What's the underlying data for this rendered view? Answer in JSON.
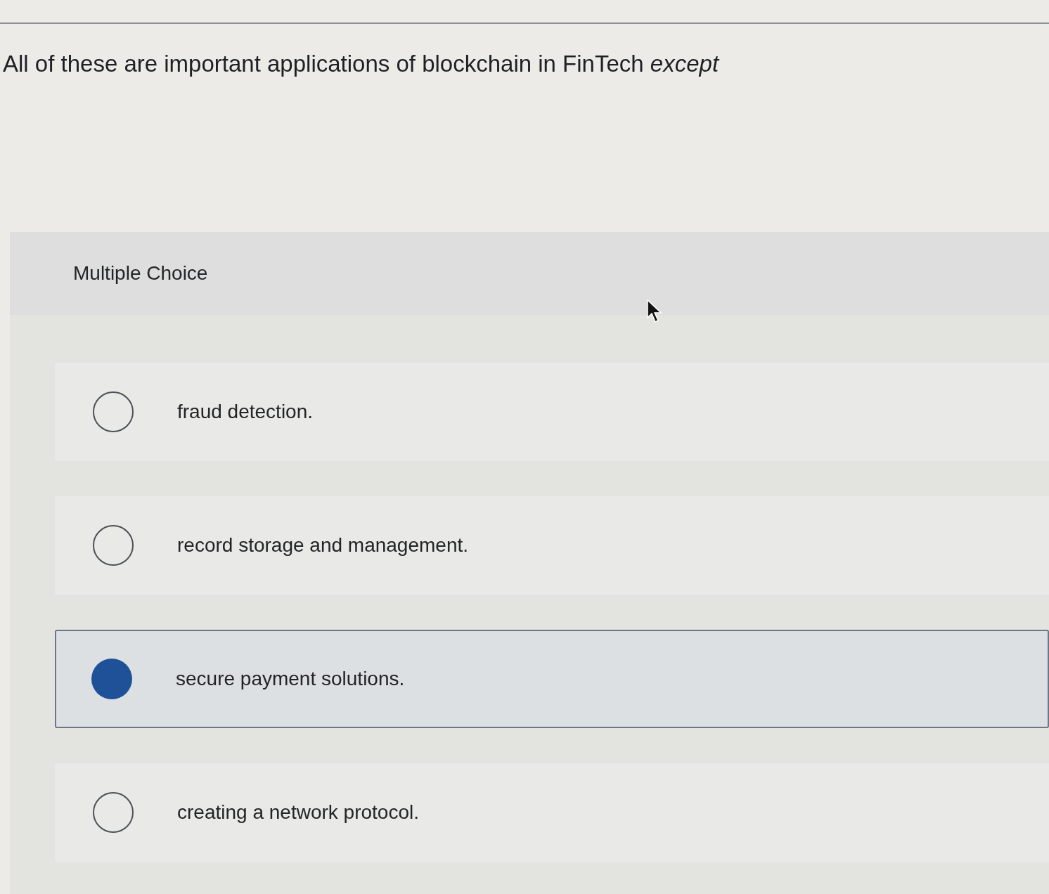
{
  "question": {
    "text": "All of these are important applications of blockchain in FinTech *except*"
  },
  "answer_panel": {
    "heading": "Multiple Choice",
    "options": [
      {
        "label": "fraud detection.",
        "selected": false
      },
      {
        "label": "record storage and management.",
        "selected": false
      },
      {
        "label": "secure payment solutions.",
        "selected": true
      },
      {
        "label": "creating a network protocol.",
        "selected": false
      }
    ]
  }
}
